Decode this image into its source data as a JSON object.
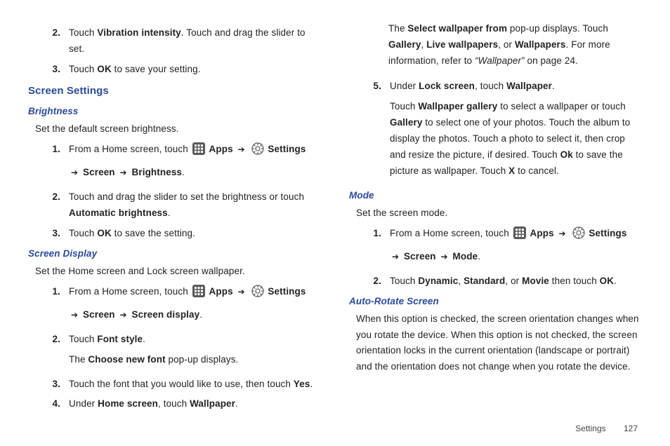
{
  "footer": {
    "section": "Settings",
    "page": "127"
  },
  "col1": {
    "top_steps": [
      {
        "n": "2.",
        "pre": "Touch ",
        "b1": "Vibration intensity",
        "post": ". Touch and drag the slider to set."
      },
      {
        "n": "3.",
        "pre": "Touch ",
        "b1": "OK",
        "post": " to save your setting."
      }
    ],
    "heading1": "Screen Settings",
    "sub_brightness": "Brightness",
    "brightness_intro": "Set the default screen brightness.",
    "brightness_steps": {
      "s1": {
        "n": "1.",
        "pre": "From a Home screen, touch ",
        "apps": "Apps",
        "settings": "Settings",
        "line2_b1": "Screen",
        "line2_b2": "Brightness"
      },
      "s2": {
        "n": "2.",
        "pre": "Touch and drag the slider to set the brightness or touch ",
        "b1": "Automatic brightness",
        "post": "."
      },
      "s3": {
        "n": "3.",
        "pre": "Touch ",
        "b1": "OK",
        "post": " to save the setting."
      }
    },
    "sub_display": "Screen Display",
    "display_intro": "Set the Home screen and Lock screen wallpaper.",
    "display_steps": {
      "s1": {
        "n": "1.",
        "pre": "From a Home screen, touch ",
        "apps": "Apps",
        "settings": "Settings",
        "line2_b1": "Screen",
        "line2_b2": "Screen display"
      },
      "s2": {
        "n": "2.",
        "pre": "Touch ",
        "b1": "Font style",
        "post": ".",
        "line2_pre": "The ",
        "line2_b1": "Choose new font",
        "line2_post": " pop-up displays."
      },
      "s3": {
        "n": "3.",
        "pre": "Touch the font that you would like to use, then touch ",
        "b1": "Yes",
        "post": "."
      },
      "s4": {
        "n": "4.",
        "pre": "Under ",
        "b1": "Home screen",
        "mid": ", touch ",
        "b2": "Wallpaper",
        "post": "."
      }
    }
  },
  "col2": {
    "cont_para": {
      "pre": "The ",
      "b1": "Select wallpaper from",
      "mid1": " pop-up displays. Touch ",
      "b2": "Gallery",
      "mid2": ", ",
      "b3": "Live wallpapers",
      "mid3": ", or ",
      "b4": "Wallpapers",
      "mid4": ". For more information, refer to ",
      "ital": "“Wallpaper”",
      "post": " on page 24."
    },
    "s5": {
      "n": "5.",
      "pre": "Under ",
      "b1": "Lock screen",
      "mid1": ", touch ",
      "b2": "Wallpaper",
      "post1": ".",
      "p2_pre": "Touch ",
      "p2_b1": "Wallpaper gallery",
      "p2_mid1": " to select a wallpaper or touch ",
      "p2_b2": "Gallery",
      "p2_mid2": " to select one of your photos. Touch the album to display the photos. Touch a photo to select it, then crop and resize the picture, if desired. Touch ",
      "p2_b3": "Ok",
      "p2_mid3": " to save the picture as wallpaper. Touch ",
      "p2_b4": "X",
      "p2_post": " to cancel."
    },
    "sub_mode": "Mode",
    "mode_intro": "Set the screen mode.",
    "mode_steps": {
      "s1": {
        "n": "1.",
        "pre": "From a Home screen, touch ",
        "apps": "Apps",
        "settings": "Settings",
        "line2_b1": "Screen",
        "line2_b2": "Mode"
      },
      "s2": {
        "n": "2.",
        "pre": "Touch ",
        "b1": "Dynamic",
        "mid1": ", ",
        "b2": "Standard",
        "mid2": ", or ",
        "b3": "Movie",
        "mid3": " then touch ",
        "b4": "OK",
        "post": "."
      }
    },
    "sub_autorotate": "Auto-Rotate Screen",
    "autorotate_para": "When this option is checked, the screen orientation changes when you rotate the device. When this option is not checked, the screen orientation locks in the current orientation (landscape or portrait) and the orientation does not change when you rotate the device."
  }
}
